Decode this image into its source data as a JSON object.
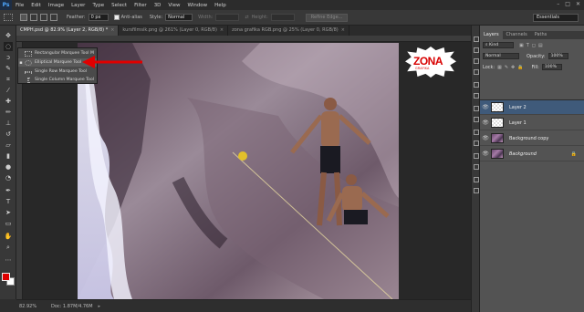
{
  "app": {
    "logo": "Ps"
  },
  "menu": [
    "File",
    "Edit",
    "Image",
    "Layer",
    "Type",
    "Select",
    "Filter",
    "3D",
    "View",
    "Window",
    "Help"
  ],
  "window_controls": [
    "–",
    "□",
    "✕"
  ],
  "options": {
    "feather_label": "Feather:",
    "feather_value": "0 px",
    "antialias_label": "Anti-alias",
    "style_label": "Style:",
    "style_value": "Normal",
    "width_label": "Width:",
    "height_label": "Height:",
    "refine_label": "Refine Edge...",
    "workspace": "Essentials"
  },
  "tabs": [
    {
      "label": "CMPH.psd @ 82.9% (Layer 2, RGB/8) *",
      "active": true
    },
    {
      "label": "kursfilmsik.png @ 261% (Layer 0, RGB/8)",
      "active": false
    },
    {
      "label": "zona grafika RGB.png @ 25% (Layer 0, RGB/8)",
      "active": false
    }
  ],
  "flyout": [
    {
      "label": "Rectangular Marquee Tool",
      "key": "M",
      "shape": "rect"
    },
    {
      "label": "Elliptical Marquee Tool",
      "key": "M",
      "shape": "ellipse",
      "selected": true
    },
    {
      "label": "Single Row Marquee Tool",
      "key": "",
      "shape": "row"
    },
    {
      "label": "Single Column Marquee Tool",
      "key": "",
      "shape": "col"
    }
  ],
  "watermark": {
    "main": "ZONA",
    "sub": "GRAFIKA"
  },
  "status": {
    "zoom": "82.92%",
    "doc": "Doc: 1.87M/4.76M"
  },
  "panel": {
    "tabs": [
      "Layers",
      "Channels",
      "Paths"
    ],
    "kind": "Kind",
    "blend": "Normal",
    "opacity_label": "Opacity:",
    "opacity": "100%",
    "lock_label": "Lock:",
    "fill_label": "Fill:",
    "fill": "100%",
    "layers": [
      {
        "name": "Layer 2",
        "thumb": "trans",
        "active": true
      },
      {
        "name": "Layer 1",
        "thumb": "trans",
        "active": false
      },
      {
        "name": "Background copy",
        "thumb": "img",
        "active": false
      },
      {
        "name": "Background",
        "thumb": "img",
        "active": false,
        "italic": true,
        "locked": true
      }
    ]
  },
  "colors": {
    "foreground": "#e00000",
    "background": "#ffffff",
    "accent": "#3f5a7a",
    "arrow": "#e00000"
  }
}
